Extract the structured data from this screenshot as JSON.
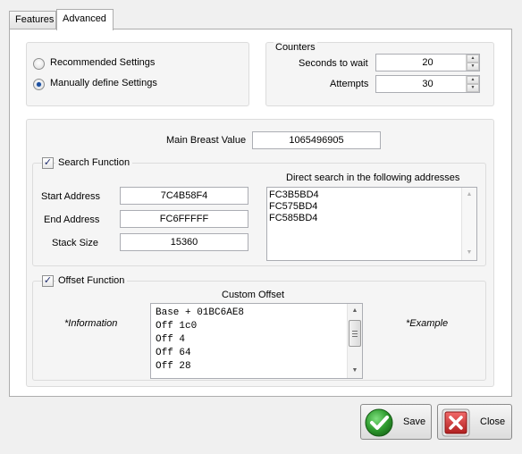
{
  "tabs": [
    {
      "label": "Features",
      "active": false
    },
    {
      "label": "Advanced",
      "active": true
    }
  ],
  "mode": {
    "options": [
      {
        "label": "Recommended Settings",
        "checked": false
      },
      {
        "label": "Manually define Settings",
        "checked": true
      }
    ]
  },
  "counters": {
    "legend": "Counters",
    "seconds_label": "Seconds to wait",
    "seconds_value": "20",
    "attempts_label": "Attempts",
    "attempts_value": "30"
  },
  "main": {
    "breast_label": "Main Breast Value",
    "breast_value": "1065496905"
  },
  "search": {
    "legend": "Search Function",
    "enabled": true,
    "start_label": "Start Address",
    "start_value": "7C4B58F4",
    "end_label": "End Address",
    "end_value": "FC6FFFFF",
    "stack_label": "Stack Size",
    "stack_value": "15360",
    "direct_label": "Direct search in the following addresses",
    "addresses": [
      "FC3B5BD4",
      "FC575BD4",
      "FC585BD4"
    ]
  },
  "offset": {
    "legend": "Offset Function",
    "enabled": true,
    "custom_label": "Custom Offset",
    "info_label": "*Information",
    "example_label": "*Example",
    "lines": [
      "Base + 01BC6AE8",
      "Off 1c0",
      "Off 4",
      "Off 64",
      "Off 28"
    ]
  },
  "buttons": {
    "save": "Save",
    "close": "Close"
  },
  "colors": {
    "save_icon": "#2e9b2e",
    "close_icon": "#c42b2b"
  }
}
